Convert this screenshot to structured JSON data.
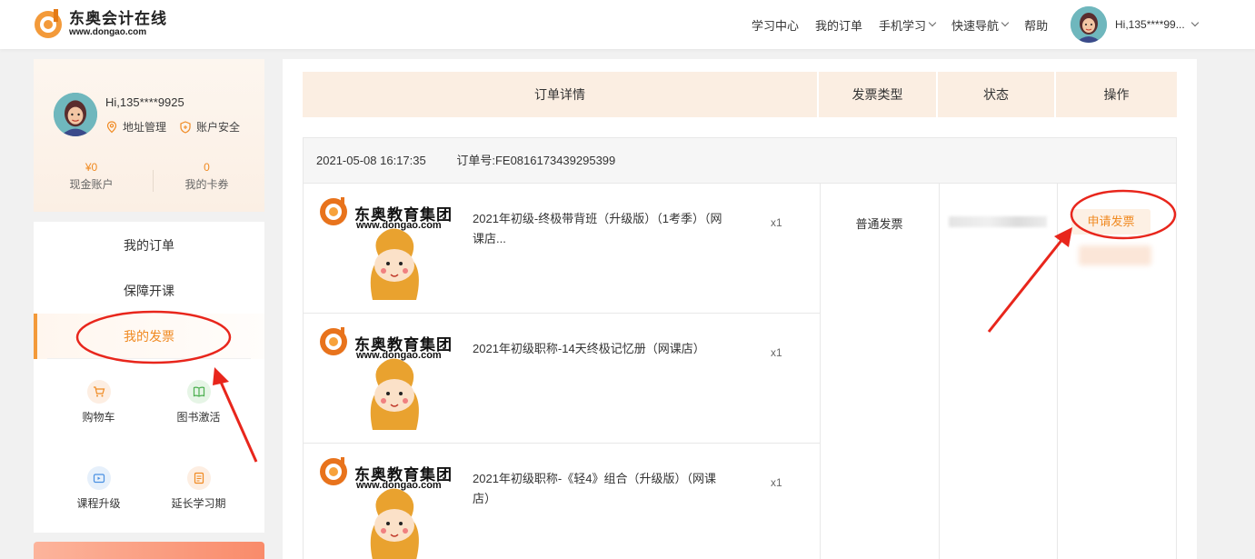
{
  "header": {
    "logo_cn": "东奥会计在线",
    "logo_url": "www.dongao.com",
    "nav": [
      {
        "label": "学习中心",
        "dropdown": false
      },
      {
        "label": "我的订单",
        "dropdown": false
      },
      {
        "label": "手机学习",
        "dropdown": true
      },
      {
        "label": "快速导航",
        "dropdown": true
      },
      {
        "label": "帮助",
        "dropdown": false
      }
    ],
    "user_label": "Hi,135****99..."
  },
  "sidebar": {
    "greeting": "Hi,135****9925",
    "address_link": "地址管理",
    "security_link": "账户安全",
    "cash_value": "¥0",
    "cash_label": "现金账户",
    "card_value": "0",
    "card_label": "我的卡券",
    "menu": [
      {
        "label": "我的订单",
        "active": false
      },
      {
        "label": "保障开课",
        "active": false
      },
      {
        "label": "我的发票",
        "active": true
      }
    ],
    "quick": [
      {
        "label": "购物车",
        "icon": "cart-icon",
        "color": "#f39a3a"
      },
      {
        "label": "图书激活",
        "icon": "book-icon",
        "color": "#4caf50"
      },
      {
        "label": "课程升级",
        "icon": "video-upgrade-icon",
        "color": "#4a90e2"
      },
      {
        "label": "延长学习期",
        "icon": "document-icon",
        "color": "#f39a3a"
      }
    ]
  },
  "table": {
    "headers": [
      "订单详情",
      "发票类型",
      "状态",
      "操作"
    ]
  },
  "order": {
    "datetime": "2021-05-08 16:17:35",
    "order_no_label": "订单号:",
    "order_no": "FE0816173439295399",
    "items": [
      {
        "name": "2021年初级-终极带背班（升级版）（1考季）（网课店...",
        "qty": "x1"
      },
      {
        "name": "2021年初级职称-14天终极记忆册（网课店）",
        "qty": "x1"
      },
      {
        "name": "2021年初级职称-《轻4》组合（升级版）（网课店）",
        "qty": "x1"
      }
    ],
    "invoice_type": "普通发票",
    "apply_button": "申请发票",
    "thumb_brand": "东奥教育集团",
    "thumb_url": "www.dongao.com"
  },
  "colors": {
    "accent": "#f08a22",
    "header_bg": "#fbeee2",
    "annotation": "#e8261c"
  }
}
